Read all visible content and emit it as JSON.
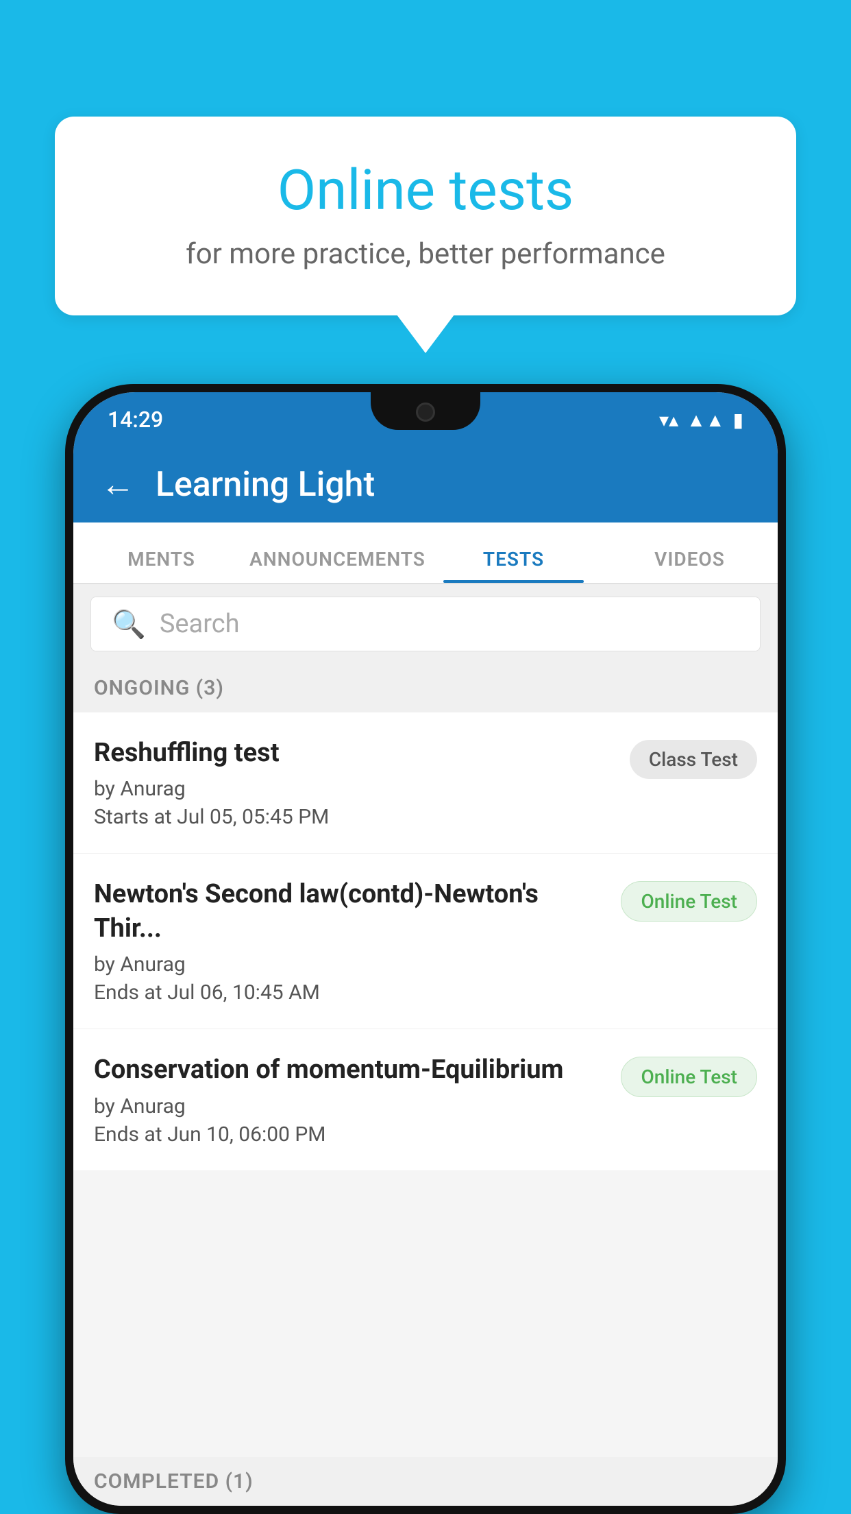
{
  "background": {
    "color": "#1ab9e8"
  },
  "speech_bubble": {
    "title": "Online tests",
    "subtitle": "for more practice, better performance"
  },
  "phone": {
    "status_bar": {
      "time": "14:29",
      "wifi": "▼",
      "signal": "▲",
      "battery": "▌"
    },
    "app_bar": {
      "back_label": "←",
      "title": "Learning Light"
    },
    "tabs": [
      {
        "label": "MENTS",
        "active": false
      },
      {
        "label": "ANNOUNCEMENTS",
        "active": false
      },
      {
        "label": "TESTS",
        "active": true
      },
      {
        "label": "VIDEOS",
        "active": false
      }
    ],
    "search": {
      "placeholder": "Search"
    },
    "ongoing_section": {
      "label": "ONGOING (3)"
    },
    "tests": [
      {
        "name": "Reshuffling test",
        "author": "by Anurag",
        "date_label": "Starts at",
        "date": "Jul 05, 05:45 PM",
        "badge": "Class Test",
        "badge_type": "class"
      },
      {
        "name": "Newton's Second law(contd)-Newton's Thir...",
        "author": "by Anurag",
        "date_label": "Ends at",
        "date": "Jul 06, 10:45 AM",
        "badge": "Online Test",
        "badge_type": "online"
      },
      {
        "name": "Conservation of momentum-Equilibrium",
        "author": "by Anurag",
        "date_label": "Ends at",
        "date": "Jun 10, 06:00 PM",
        "badge": "Online Test",
        "badge_type": "online"
      }
    ],
    "completed_section": {
      "label": "COMPLETED (1)"
    }
  }
}
